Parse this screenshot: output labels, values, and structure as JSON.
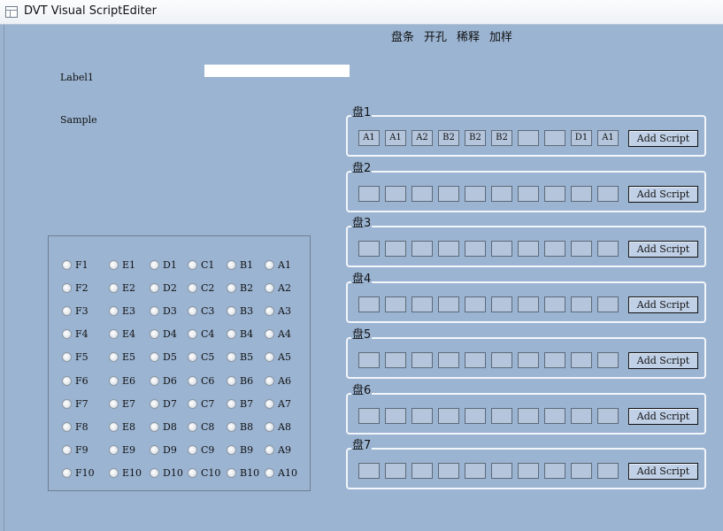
{
  "window": {
    "title": "DVT Visual ScriptEditer"
  },
  "menu": [
    "盘条",
    "开孔",
    "稀释",
    "加样"
  ],
  "labels": {
    "label1": "Label1",
    "sample": "Sample"
  },
  "input": {
    "value": ""
  },
  "radios": {
    "columns": [
      "F",
      "E",
      "D",
      "C",
      "B",
      "A"
    ],
    "rows": [
      1,
      2,
      3,
      4,
      5,
      6,
      7,
      8,
      9,
      10
    ]
  },
  "plates": [
    {
      "title": "盘1",
      "slots": [
        "A1",
        "A1",
        "A2",
        "B2",
        "B2",
        "B2",
        "",
        "",
        "D1",
        "A1"
      ],
      "button": "Add Script"
    },
    {
      "title": "盘2",
      "slots": [
        "",
        "",
        "",
        "",
        "",
        "",
        "",
        "",
        "",
        ""
      ],
      "button": "Add Script"
    },
    {
      "title": "盘3",
      "slots": [
        "",
        "",
        "",
        "",
        "",
        "",
        "",
        "",
        "",
        ""
      ],
      "button": "Add Script"
    },
    {
      "title": "盘4",
      "slots": [
        "",
        "",
        "",
        "",
        "",
        "",
        "",
        "",
        "",
        ""
      ],
      "button": "Add Script"
    },
    {
      "title": "盘5",
      "slots": [
        "",
        "",
        "",
        "",
        "",
        "",
        "",
        "",
        "",
        ""
      ],
      "button": "Add Script"
    },
    {
      "title": "盘6",
      "slots": [
        "",
        "",
        "",
        "",
        "",
        "",
        "",
        "",
        "",
        ""
      ],
      "button": "Add Script"
    },
    {
      "title": "盘7",
      "slots": [
        "",
        "",
        "",
        "",
        "",
        "",
        "",
        "",
        "",
        ""
      ],
      "button": "Add Script"
    }
  ]
}
